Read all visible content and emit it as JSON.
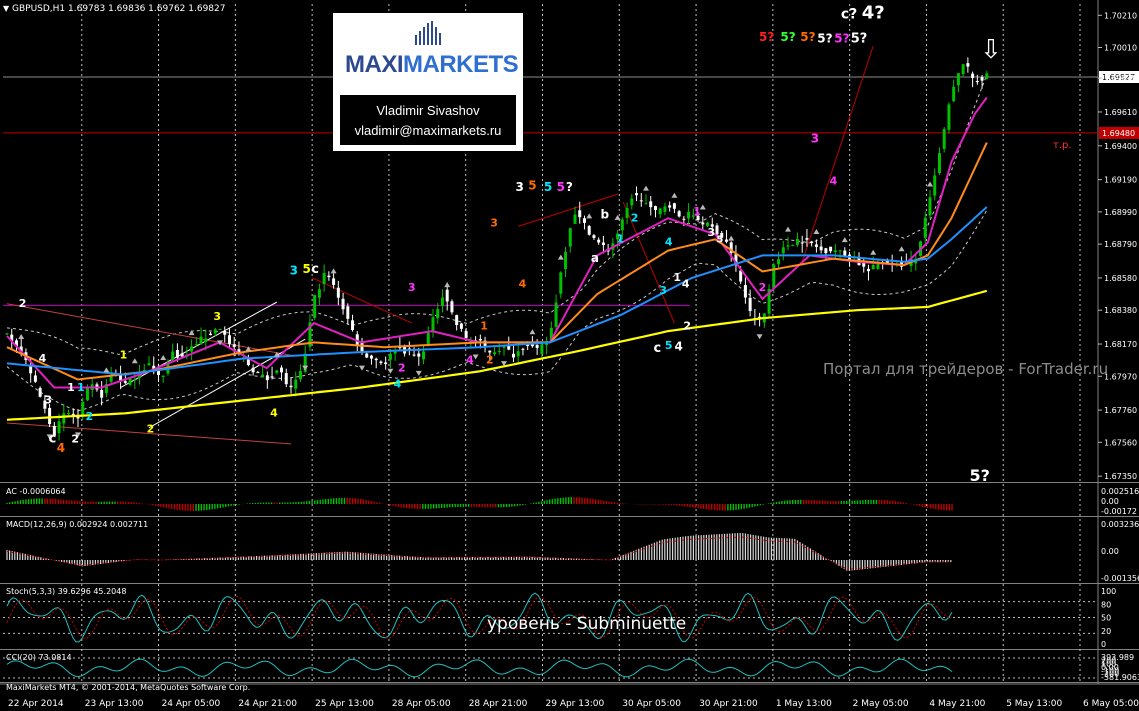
{
  "window": {
    "symbol_header": "GBPUSD,H1  1.69783  1.69836  1.69762  1.69827",
    "platform_footer": "MaxiMarkets MT4, © 2001-2014, MetaQuotes Software Corp."
  },
  "watermark": {
    "brand_maxi": "MAXI",
    "brand_markets": "MARKETS",
    "author_name": "Vladimir Sivashov",
    "author_email": "vladimir@maximarkets.ru",
    "portal_text": "Портал для трейдеров - ForTrader.ru",
    "level_text": "уровень - Subminuette"
  },
  "colors": {
    "background": "#000000",
    "bull_candle": "#00c000",
    "bear_candle": "#ffffff",
    "ma_fast": "#e020c0",
    "ma_mid": "#ff8c1a",
    "ma_slow": "#1e90ff",
    "ma_long": "#ffff00",
    "bollinger": "#c8c8c8",
    "channel_upper": "#c000c0",
    "target_line": "#c00000",
    "bid_line": "#8c8c8c",
    "wave_white": "#ffffff",
    "wave_yellow": "#ffff00",
    "wave_orange": "#ff6a00",
    "wave_cyan": "#00e5ff",
    "wave_magenta": "#ff33ff",
    "wave_red": "#ff2020",
    "wave_green": "#33ff33",
    "grid": "#ffffff",
    "axis_text": "#ffffff"
  },
  "chart_data": {
    "type": "candlestick",
    "symbol": "GBPUSD",
    "timeframe": "H1",
    "header_ohlc": {
      "open": 1.69783,
      "high": 1.69836,
      "low": 1.69762,
      "close": 1.69827
    },
    "current_price": 1.69827,
    "current_price_label": "1.69827",
    "target_level": 1.6948,
    "target_level_label": "1.69480",
    "target_label": "т.р.",
    "channel_level": 1.6841,
    "ylim": [
      1.6732,
      1.7028
    ],
    "price_ticks": [
      "1.70210",
      "1.70010",
      "1.69820",
      "1.69610",
      "1.69400",
      "1.69190",
      "1.68990",
      "1.68790",
      "1.68580",
      "1.68380",
      "1.68170",
      "1.67970",
      "1.67760",
      "1.67560",
      "1.67350"
    ],
    "x_labels": [
      "22 Apr 2014",
      "23 Apr 13:00",
      "24 Apr 05:00",
      "24 Apr 21:00",
      "25 Apr 13:00",
      "28 Apr 05:00",
      "28 Apr 21:00",
      "29 Apr 13:00",
      "30 Apr 05:00",
      "30 Apr 21:00",
      "1 May 13:00",
      "2 May 05:00",
      "4 May 21:00",
      "5 May 13:00",
      "6 May 05:00"
    ],
    "path_keys": [
      [
        0,
        1.6825
      ],
      [
        1,
        1.6815
      ],
      [
        2,
        1.68
      ],
      [
        3,
        1.678
      ],
      [
        4,
        1.6762
      ],
      [
        5,
        1.6775
      ],
      [
        6,
        1.677
      ],
      [
        7,
        1.6792
      ],
      [
        8,
        1.6785
      ],
      [
        9,
        1.68
      ],
      [
        10,
        1.6792
      ],
      [
        11,
        1.6798
      ],
      [
        12,
        1.6805
      ],
      [
        13,
        1.6795
      ],
      [
        14,
        1.6812
      ],
      [
        15,
        1.6808
      ],
      [
        16,
        1.6818
      ],
      [
        17,
        1.6822
      ],
      [
        18,
        1.6828
      ],
      [
        19,
        1.6815
      ],
      [
        20,
        1.6808
      ],
      [
        21,
        1.68
      ],
      [
        22,
        1.6795
      ],
      [
        23,
        1.6802
      ],
      [
        24,
        1.6788
      ],
      [
        25,
        1.68
      ],
      [
        26,
        1.6845
      ],
      [
        27,
        1.6862
      ],
      [
        28,
        1.6848
      ],
      [
        29,
        1.683
      ],
      [
        30,
        1.6812
      ],
      [
        31,
        1.6808
      ],
      [
        32,
        1.6805
      ],
      [
        33,
        1.6815
      ],
      [
        34,
        1.6812
      ],
      [
        35,
        1.6808
      ],
      [
        36,
        1.683
      ],
      [
        37,
        1.685
      ],
      [
        38,
        1.683
      ],
      [
        39,
        1.682
      ],
      [
        40,
        1.6818
      ],
      [
        41,
        1.6812
      ],
      [
        42,
        1.6815
      ],
      [
        43,
        1.681
      ],
      [
        44,
        1.6818
      ],
      [
        45,
        1.6812
      ],
      [
        46,
        1.6822
      ],
      [
        47,
        1.6865
      ],
      [
        48,
        1.69
      ],
      [
        49,
        1.689
      ],
      [
        50,
        1.688
      ],
      [
        51,
        1.6875
      ],
      [
        52,
        1.689
      ],
      [
        53,
        1.691
      ],
      [
        54,
        1.6905
      ],
      [
        55,
        1.6898
      ],
      [
        56,
        1.6905
      ],
      [
        57,
        1.6895
      ],
      [
        58,
        1.6898
      ],
      [
        59,
        1.6892
      ],
      [
        60,
        1.6888
      ],
      [
        61,
        1.688
      ],
      [
        62,
        1.686
      ],
      [
        63,
        1.6835
      ],
      [
        64,
        1.683
      ],
      [
        65,
        1.6868
      ],
      [
        66,
        1.6878
      ],
      [
        67,
        1.6882
      ],
      [
        68,
        1.688
      ],
      [
        69,
        1.6875
      ],
      [
        70,
        1.6876
      ],
      [
        71,
        1.6872
      ],
      [
        72,
        1.6868
      ],
      [
        73,
        1.6862
      ],
      [
        74,
        1.6868
      ],
      [
        75,
        1.6868
      ],
      [
        76,
        1.6866
      ],
      [
        77,
        1.687
      ],
      [
        78,
        1.69
      ],
      [
        79,
        1.6935
      ],
      [
        80,
        1.6972
      ],
      [
        81,
        1.6992
      ],
      [
        82,
        1.698
      ],
      [
        83,
        1.6983
      ]
    ],
    "moving_averages": [
      {
        "color_key": "ma_fast",
        "keys": [
          [
            0,
            1.6822
          ],
          [
            4,
            1.679
          ],
          [
            8,
            1.679
          ],
          [
            12,
            1.68
          ],
          [
            18,
            1.6818
          ],
          [
            22,
            1.6802
          ],
          [
            26,
            1.683
          ],
          [
            30,
            1.6818
          ],
          [
            36,
            1.6825
          ],
          [
            40,
            1.6818
          ],
          [
            46,
            1.6818
          ],
          [
            50,
            1.6872
          ],
          [
            56,
            1.6895
          ],
          [
            60,
            1.6885
          ],
          [
            64,
            1.6845
          ],
          [
            68,
            1.6872
          ],
          [
            72,
            1.6868
          ],
          [
            76,
            1.6866
          ],
          [
            78,
            1.688
          ],
          [
            80,
            1.693
          ],
          [
            82,
            1.696
          ],
          [
            83,
            1.697
          ]
        ]
      },
      {
        "color_key": "ma_mid",
        "keys": [
          [
            0,
            1.6815
          ],
          [
            6,
            1.6795
          ],
          [
            12,
            1.68
          ],
          [
            20,
            1.6812
          ],
          [
            26,
            1.6818
          ],
          [
            32,
            1.6815
          ],
          [
            40,
            1.6818
          ],
          [
            46,
            1.6818
          ],
          [
            50,
            1.6848
          ],
          [
            56,
            1.6875
          ],
          [
            60,
            1.6882
          ],
          [
            64,
            1.6862
          ],
          [
            70,
            1.687
          ],
          [
            76,
            1.6866
          ],
          [
            78,
            1.6872
          ],
          [
            80,
            1.6895
          ],
          [
            83,
            1.6942
          ]
        ]
      },
      {
        "color_key": "ma_slow",
        "keys": [
          [
            0,
            1.6805
          ],
          [
            10,
            1.6798
          ],
          [
            20,
            1.6808
          ],
          [
            30,
            1.6812
          ],
          [
            40,
            1.6815
          ],
          [
            46,
            1.6818
          ],
          [
            52,
            1.6835
          ],
          [
            58,
            1.6858
          ],
          [
            64,
            1.6872
          ],
          [
            70,
            1.6872
          ],
          [
            76,
            1.6868
          ],
          [
            78,
            1.687
          ],
          [
            80,
            1.6882
          ],
          [
            83,
            1.6902
          ]
        ]
      },
      {
        "color_key": "ma_long",
        "keys": [
          [
            0,
            1.677
          ],
          [
            10,
            1.6774
          ],
          [
            20,
            1.6782
          ],
          [
            30,
            1.679
          ],
          [
            40,
            1.68
          ],
          [
            48,
            1.6812
          ],
          [
            56,
            1.6825
          ],
          [
            64,
            1.6833
          ],
          [
            72,
            1.6838
          ],
          [
            78,
            1.684
          ],
          [
            83,
            1.685
          ]
        ]
      }
    ],
    "wave_labels": [
      {
        "text": "c",
        "bar": 3.2,
        "price": 1.6756,
        "color_key": "wave_white",
        "size": 13
      },
      {
        "text": "4",
        "bar": 3.8,
        "price": 1.675,
        "color_key": "wave_orange",
        "size": 12
      },
      {
        "text": "2",
        "bar": 4.8,
        "price": 1.6756,
        "color_key": "wave_white",
        "size": 11
      },
      {
        "text": "2",
        "bar": 1.1,
        "price": 1.684,
        "color_key": "wave_white",
        "size": 11
      },
      {
        "text": "4",
        "bar": 2.5,
        "price": 1.6806,
        "color_key": "wave_white",
        "size": 11
      },
      {
        "text": "3",
        "bar": 2.9,
        "price": 1.678,
        "color_key": "wave_white",
        "size": 11
      },
      {
        "text": "1",
        "bar": 4.5,
        "price": 1.6788,
        "color_key": "wave_white",
        "size": 11
      },
      {
        "text": "1",
        "bar": 5.2,
        "price": 1.6788,
        "color_key": "wave_cyan",
        "size": 11
      },
      {
        "text": "2",
        "bar": 5.8,
        "price": 1.677,
        "color_key": "wave_cyan",
        "size": 11
      },
      {
        "text": "1",
        "bar": 8.2,
        "price": 1.6808,
        "color_key": "wave_yellow",
        "size": 11
      },
      {
        "text": "2",
        "bar": 10.1,
        "price": 1.6762,
        "color_key": "wave_yellow",
        "size": 11
      },
      {
        "text": "3",
        "bar": 14.8,
        "price": 1.6832,
        "color_key": "wave_yellow",
        "size": 11
      },
      {
        "text": "4",
        "bar": 18.8,
        "price": 1.6772,
        "color_key": "wave_yellow",
        "size": 11
      },
      {
        "text": "3",
        "bar": 20.2,
        "price": 1.686,
        "color_key": "wave_cyan",
        "size": 12
      },
      {
        "text": "5",
        "bar": 21.1,
        "price": 1.6861,
        "color_key": "wave_yellow",
        "size": 12
      },
      {
        "text": "c",
        "bar": 21.7,
        "price": 1.6861,
        "color_key": "wave_white",
        "size": 13
      },
      {
        "text": "4",
        "bar": 27.5,
        "price": 1.679,
        "color_key": "wave_cyan",
        "size": 11
      },
      {
        "text": "3",
        "bar": 28.5,
        "price": 1.685,
        "color_key": "wave_magenta",
        "size": 11
      },
      {
        "text": "2",
        "bar": 27.8,
        "price": 1.68,
        "color_key": "wave_magenta",
        "size": 11
      },
      {
        "text": "4",
        "bar": 32.6,
        "price": 1.6805,
        "color_key": "wave_magenta",
        "size": 11
      },
      {
        "text": "1",
        "bar": 33.6,
        "price": 1.6826,
        "color_key": "wave_orange",
        "size": 11
      },
      {
        "text": "2",
        "bar": 34.0,
        "price": 1.6805,
        "color_key": "wave_orange",
        "size": 11
      },
      {
        "text": "3",
        "bar": 34.3,
        "price": 1.689,
        "color_key": "wave_orange",
        "size": 11
      },
      {
        "text": "4",
        "bar": 36.3,
        "price": 1.6852,
        "color_key": "wave_orange",
        "size": 11
      },
      {
        "text": "3",
        "bar": 36.1,
        "price": 1.6912,
        "color_key": "wave_white",
        "size": 12
      },
      {
        "text": "5",
        "bar": 37.0,
        "price": 1.6913,
        "color_key": "wave_orange",
        "size": 12
      },
      {
        "text": "5",
        "bar": 38.1,
        "price": 1.6912,
        "color_key": "wave_cyan",
        "size": 12
      },
      {
        "text": "5",
        "bar": 39.0,
        "price": 1.6912,
        "color_key": "wave_magenta",
        "size": 12
      },
      {
        "text": "?",
        "bar": 39.6,
        "price": 1.6912,
        "color_key": "wave_white",
        "size": 12
      },
      {
        "text": "b",
        "bar": 42.1,
        "price": 1.6895,
        "color_key": "wave_white",
        "size": 12
      },
      {
        "text": "a",
        "bar": 41.4,
        "price": 1.6868,
        "color_key": "wave_white",
        "size": 12
      },
      {
        "text": "1",
        "bar": 43.2,
        "price": 1.688,
        "color_key": "wave_cyan",
        "size": 11
      },
      {
        "text": "2",
        "bar": 44.2,
        "price": 1.6893,
        "color_key": "wave_cyan",
        "size": 11
      },
      {
        "text": "4",
        "bar": 46.6,
        "price": 1.6878,
        "color_key": "wave_cyan",
        "size": 11
      },
      {
        "text": "3",
        "bar": 46.2,
        "price": 1.6848,
        "color_key": "wave_cyan",
        "size": 11
      },
      {
        "text": "1",
        "bar": 47.2,
        "price": 1.6856,
        "color_key": "wave_white",
        "size": 11
      },
      {
        "text": "2",
        "bar": 47.9,
        "price": 1.6826,
        "color_key": "wave_white",
        "size": 11
      },
      {
        "text": "c",
        "bar": 45.8,
        "price": 1.6812,
        "color_key": "wave_white",
        "size": 13
      },
      {
        "text": "5",
        "bar": 46.6,
        "price": 1.6814,
        "color_key": "wave_cyan",
        "size": 11
      },
      {
        "text": "4",
        "bar": 47.3,
        "price": 1.6813,
        "color_key": "wave_white",
        "size": 12
      },
      {
        "text": "4",
        "bar": 47.8,
        "price": 1.6852,
        "color_key": "wave_white",
        "size": 11
      },
      {
        "text": "1",
        "bar": 48.6,
        "price": 1.6897,
        "color_key": "wave_magenta",
        "size": 11
      },
      {
        "text": "3",
        "bar": 49.6,
        "price": 1.6884,
        "color_key": "wave_white",
        "size": 11
      },
      {
        "text": "5",
        "bar": 50.2,
        "price": 1.688,
        "color_key": "wave_white",
        "size": 10
      },
      {
        "text": "2",
        "bar": 53.2,
        "price": 1.685,
        "color_key": "wave_magenta",
        "size": 11
      },
      {
        "text": "3",
        "bar": 56.9,
        "price": 1.6942,
        "color_key": "wave_magenta",
        "size": 12
      },
      {
        "text": "4",
        "bar": 58.2,
        "price": 1.6916,
        "color_key": "wave_magenta",
        "size": 11
      },
      {
        "text": "5?",
        "bar": 53.5,
        "price": 1.7005,
        "color_key": "wave_red",
        "size": 12
      },
      {
        "text": "5?",
        "bar": 55.0,
        "price": 1.7005,
        "color_key": "wave_green",
        "size": 12
      },
      {
        "text": "5?",
        "bar": 56.4,
        "price": 1.7005,
        "color_key": "wave_orange",
        "size": 12
      },
      {
        "text": "5?",
        "bar": 57.6,
        "price": 1.7004,
        "color_key": "wave_white",
        "size": 12
      },
      {
        "text": "5?",
        "bar": 58.8,
        "price": 1.7004,
        "color_key": "wave_magenta",
        "size": 12
      },
      {
        "text": "5?",
        "bar": 60.0,
        "price": 1.7004,
        "color_key": "wave_white",
        "size": 13
      },
      {
        "text": "c?",
        "bar": 59.3,
        "price": 1.7019,
        "color_key": "wave_white",
        "size": 14
      },
      {
        "text": "4?",
        "bar": 61.0,
        "price": 1.7019,
        "color_key": "wave_white",
        "size": 18
      },
      {
        "text": "5?",
        "bar": 68.5,
        "price": 1.6732,
        "color_key": "wave_white",
        "size": 16
      }
    ],
    "indicators": [
      {
        "name": "AC",
        "label": "AC -0.0006064",
        "ticks": [
          "0.002516",
          "0.00",
          "-0.00172"
        ]
      },
      {
        "name": "MACD",
        "label": "MACD(12,26,9) 0.002924 0.002711",
        "ticks": [
          "0.003236",
          "0.00",
          "-0.001356"
        ]
      },
      {
        "name": "Stoch",
        "label": "Stoch(5,3,3) 39.6296 45.2048",
        "ticks": [
          "100",
          "80",
          "50",
          "20",
          "0"
        ]
      },
      {
        "name": "CCI",
        "label": "CCI(20) 73.0814",
        "ticks": [
          "393.989",
          "200",
          "100",
          "0.00",
          "-100",
          "-200",
          "-381.9063"
        ]
      }
    ]
  }
}
